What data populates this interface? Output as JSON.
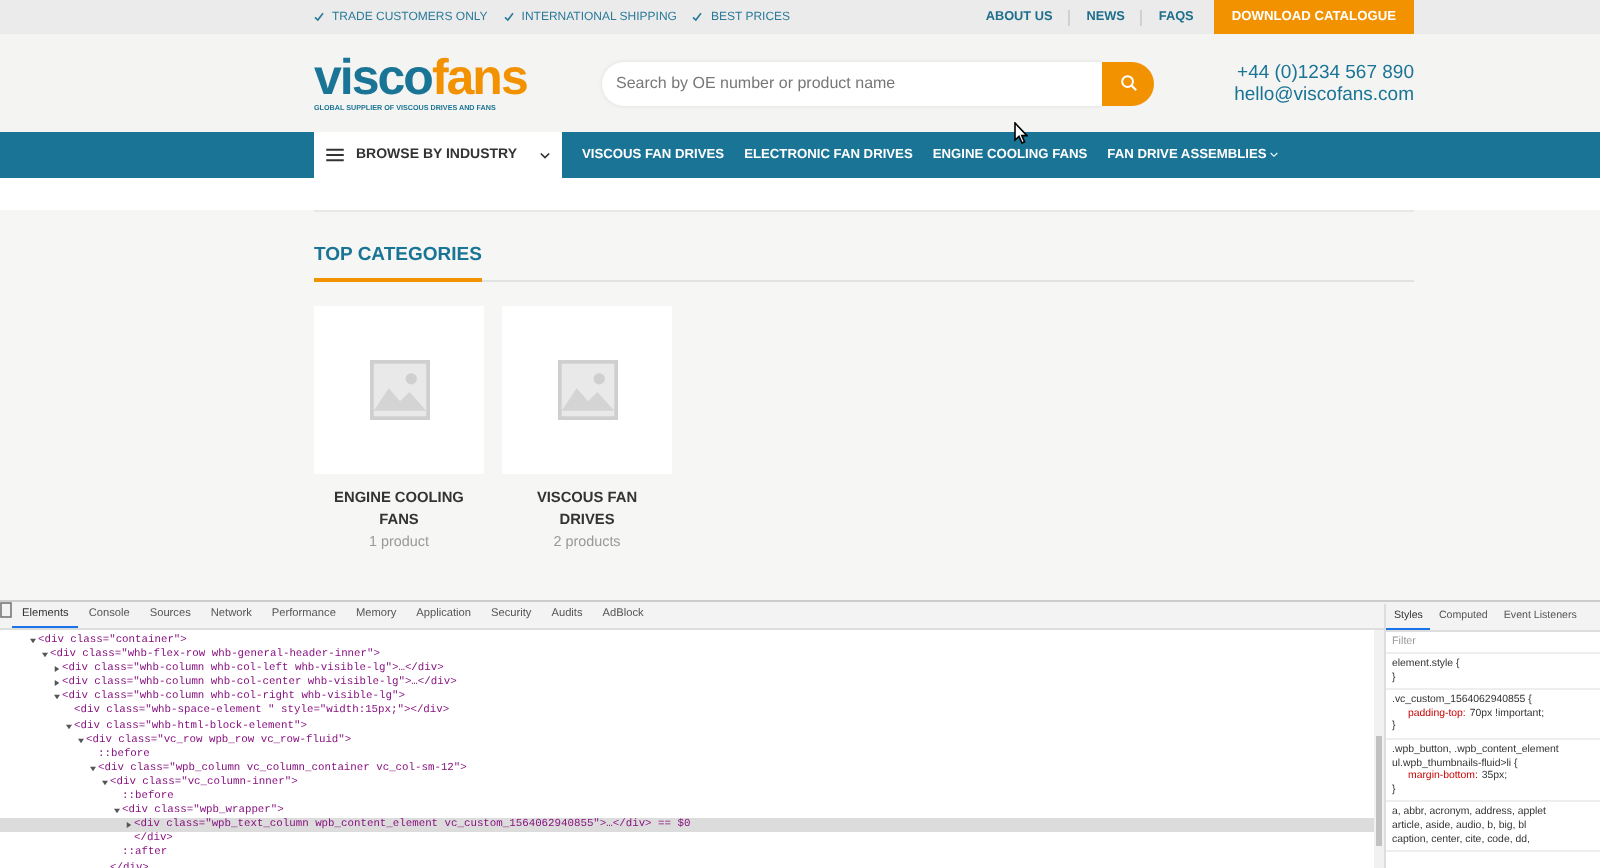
{
  "top_bar": {
    "benefits": [
      "TRADE CUSTOMERS ONLY",
      "INTERNATIONAL SHIPPING",
      "BEST PRICES"
    ],
    "links": [
      "ABOUT US",
      "NEWS",
      "FAQS"
    ],
    "cta": "DOWNLOAD CATALOGUE"
  },
  "header": {
    "logo": {
      "primary": "visco",
      "accent": "fans",
      "tagline": "GLOBAL SUPPLIER OF VISCOUS DRIVES AND FANS"
    },
    "search": {
      "placeholder": "Search by OE number or product name"
    },
    "phone": "+44 (0)1234 567 890",
    "email": "hello@viscofans.com"
  },
  "nav": {
    "browse": {
      "label": "BROWSE BY INDUSTRY"
    },
    "items": [
      {
        "label": "VISCOUS FAN DRIVES",
        "has_menu": false
      },
      {
        "label": "ELECTRONIC FAN DRIVES",
        "has_menu": false
      },
      {
        "label": "ENGINE COOLING FANS",
        "has_menu": false
      },
      {
        "label": "FAN DRIVE ASSEMBLIES",
        "has_menu": true
      }
    ]
  },
  "categories": {
    "title": "TOP CATEGORIES",
    "items": [
      {
        "name": "ENGINE COOLING FANS",
        "count": "1 product"
      },
      {
        "name": "VISCOUS FAN DRIVES",
        "count": "2 products"
      }
    ]
  },
  "devtools": {
    "tabs": [
      {
        "label": "Elements",
        "selected": true
      },
      {
        "label": "Console",
        "selected": false
      },
      {
        "label": "Sources",
        "selected": false
      },
      {
        "label": "Network",
        "selected": false
      },
      {
        "label": "Performance",
        "selected": false
      },
      {
        "label": "Memory",
        "selected": false
      },
      {
        "label": "Application",
        "selected": false
      },
      {
        "label": "Security",
        "selected": false
      },
      {
        "label": "Audits",
        "selected": false
      },
      {
        "label": "AdBlock",
        "selected": false
      }
    ],
    "dom_tree": [
      {
        "text": "<div class=\"container\">",
        "expanded": true,
        "selected": false,
        "children": [
          {
            "text": "<div class=\"whb-flex-row whb-general-header-inner\">",
            "expanded": true,
            "selected": false,
            "children": [
              {
                "text": "<div class=\"whb-column whb-col-left whb-visible-lg\">…</div>",
                "expanded": false,
                "selected": false
              },
              {
                "text": "<div class=\"whb-column whb-col-center whb-visible-lg\">…</div>",
                "expanded": false,
                "selected": false
              },
              {
                "text": "<div class=\"whb-column whb-col-right whb-visible-lg\">",
                "expanded": true,
                "selected": false,
                "children": [
                  {
                    "text": "<div class=\"whb-space-element \" style=\"width:15px;\"></div>",
                    "selected": false
                  },
                  {
                    "text": "<div class=\"whb-html-block-element\">",
                    "expanded": true,
                    "selected": false,
                    "children": [
                      {
                        "text": "<div class=\"vc_row wpb_row vc_row-fluid\">",
                        "expanded": true,
                        "selected": false,
                        "children": [
                          {
                            "text": "::before",
                            "selected": false
                          },
                          {
                            "text": "<div class=\"wpb_column vc_column_container vc_col-sm-12\">",
                            "expanded": true,
                            "selected": false,
                            "children": [
                              {
                                "text": "<div class=\"vc_column-inner\">",
                                "expanded": true,
                                "selected": false,
                                "children": [
                                  {
                                    "text": "::before",
                                    "selected": false
                                  },
                                  {
                                    "text": "<div class=\"wpb_wrapper\">",
                                    "expanded": true,
                                    "selected": false,
                                    "children": [
                                      {
                                        "text": "<div class=\"wpb_text_column wpb_content_element vc_custom_1564062940855\">…</div> == $0",
                                        "expanded": false,
                                        "selected": true
                                      },
                                      {
                                        "text": "</div>",
                                        "selected": false
                                      }
                                    ]
                                  },
                                  {
                                    "text": "::after",
                                    "selected": false
                                  }
                                ]
                              },
                              {
                                "text": "</div>",
                                "selected": false
                              }
                            ]
                          }
                        ]
                      }
                    ]
                  }
                ]
              }
            ]
          }
        ]
      }
    ],
    "side_tabs": [
      {
        "label": "Styles",
        "selected": true
      },
      {
        "label": "Computed",
        "selected": false
      },
      {
        "label": "Event Listeners",
        "selected": false
      }
    ],
    "filter": {
      "placeholder": "Filter"
    },
    "style_rules": [
      {
        "selector_lines": [
          "element.style {"
        ],
        "close": "}"
      },
      {
        "selector_lines": [
          ".vc_custom_1564062940855 {"
        ],
        "declarations": [
          {
            "property": "padding-top:",
            "value": "70px !important;"
          }
        ],
        "close": "}"
      },
      {
        "selector_lines": [
          ".wpb_button, .wpb_content_element",
          "ul.wpb_thumbnails-fluid>li {"
        ],
        "declarations": [
          {
            "property": "margin-bottom:",
            "value": "35px;"
          }
        ],
        "close": "}"
      },
      {
        "selector_lines": [
          "a, abbr, acronym, address, applet",
          "article, aside, audio, b, big, bl",
          "caption, center, cite, code, dd,"
        ]
      }
    ]
  }
}
